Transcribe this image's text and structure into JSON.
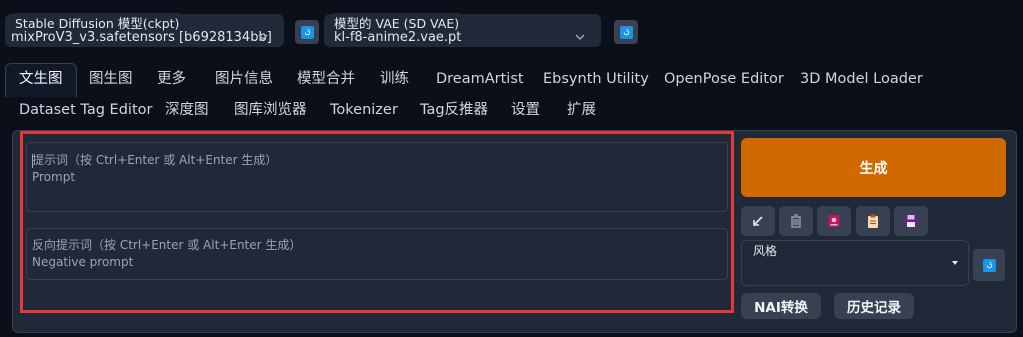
{
  "top": {
    "checkpoint_label": "Stable Diffusion 模型(ckpt)",
    "checkpoint_value": "mixProV3_v3.safetensors [b6928134bb]",
    "vae_label": "模型的 VAE (SD VAE)",
    "vae_value": "kl-f8-anime2.vae.pt"
  },
  "tabs": [
    {
      "label": "文生图"
    },
    {
      "label": "图生图"
    },
    {
      "label": "更多"
    },
    {
      "label": "图片信息"
    },
    {
      "label": "模型合并"
    },
    {
      "label": "训练"
    },
    {
      "label": "DreamArtist"
    },
    {
      "label": "Ebsynth Utility"
    },
    {
      "label": "OpenPose Editor"
    },
    {
      "label": "3D Model Loader"
    },
    {
      "label": "Dataset Tag Editor"
    },
    {
      "label": "深度图"
    },
    {
      "label": "图库浏览器"
    },
    {
      "label": "Tokenizer"
    },
    {
      "label": "Tag反推器"
    },
    {
      "label": "设置"
    },
    {
      "label": "扩展"
    }
  ],
  "prompt": {
    "placeholder_line1": "提示词（按 Ctrl+Enter 或 Alt+Enter 生成）",
    "placeholder_line2": "Prompt"
  },
  "negative_prompt": {
    "placeholder_line1": "反向提示词（按 Ctrl+Enter 或 Alt+Enter 生成）",
    "placeholder_line2": "Negative prompt"
  },
  "actions": {
    "generate_label": "生成",
    "style_label": "风格",
    "nai_button_label": "NAI转换",
    "history_button_label": "历史记录"
  },
  "tool_icons": [
    "arrow-icon",
    "trash-icon",
    "extra-networks-icon",
    "clipboard-icon",
    "save-icon"
  ],
  "colors": {
    "accent": "#d06a00",
    "highlight_box": "#e53939",
    "refresh_icon": "#1a94e8"
  }
}
